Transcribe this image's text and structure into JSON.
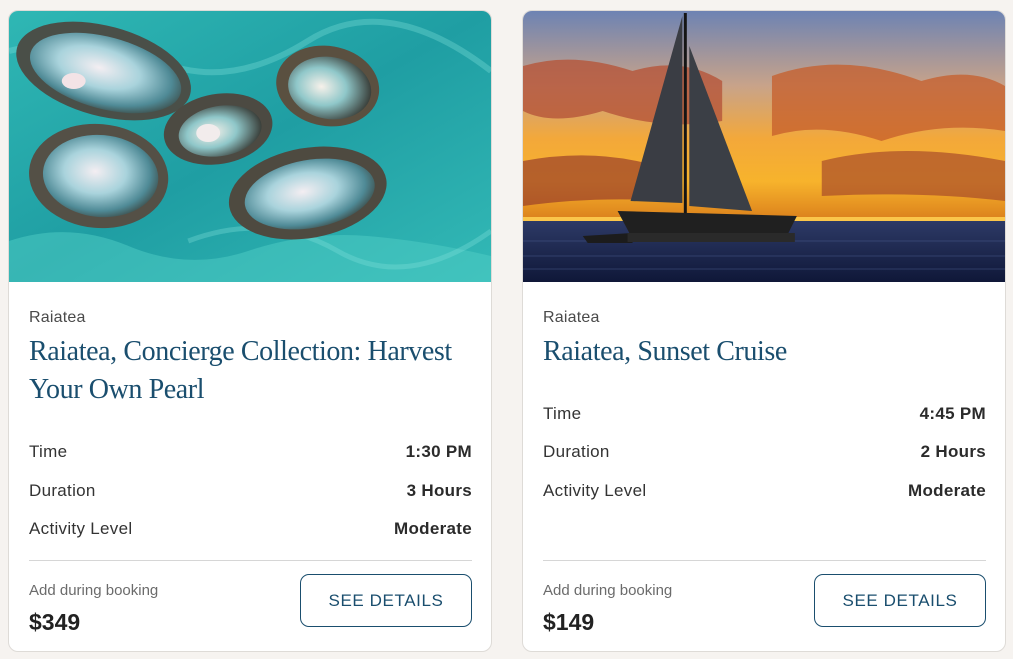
{
  "cards": [
    {
      "location": "Raiatea",
      "title": "Raiatea, Concierge Collection: Harvest Your Own Pearl",
      "details": [
        {
          "label": "Time",
          "value": "1:30 PM"
        },
        {
          "label": "Duration",
          "value": "3 Hours"
        },
        {
          "label": "Activity Level",
          "value": "Moderate"
        }
      ],
      "add_note": "Add during booking",
      "price": "$349",
      "button": "SEE DETAILS"
    },
    {
      "location": "Raiatea",
      "title": "Raiatea, Sunset Cruise",
      "details": [
        {
          "label": "Time",
          "value": "4:45 PM"
        },
        {
          "label": "Duration",
          "value": "2 Hours"
        },
        {
          "label": "Activity Level",
          "value": "Moderate"
        }
      ],
      "add_note": "Add during booking",
      "price": "$149",
      "button": "SEE DETAILS"
    }
  ],
  "colors": {
    "accent": "#1a4e6e",
    "background": "#f6f3f0"
  }
}
